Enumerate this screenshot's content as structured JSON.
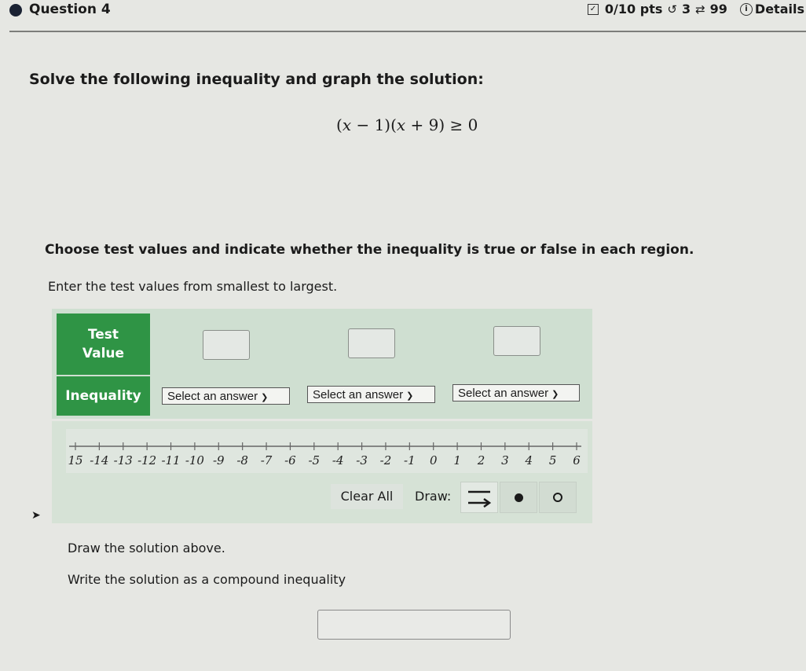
{
  "header": {
    "question_title": "Question 4",
    "points": "0/10 pts",
    "retries": "3",
    "attempts": "99",
    "details_label": "Details",
    "icons": [
      "checkbox-icon",
      "undo-icon",
      "repeat-icon",
      "info-icon"
    ]
  },
  "prompt": "Solve the following inequality and graph the solution:",
  "equation": {
    "parts": [
      "(",
      "x",
      " − 1)(",
      "x",
      " + 9) ≥ 0"
    ]
  },
  "instructions": {
    "choose": "Choose test values and indicate whether the inequality is true or false in each region.",
    "order": "Enter the test values from smallest to largest.",
    "draw": "Draw the solution above.",
    "compound": "Write the solution as a compound inequality"
  },
  "table": {
    "row1_label": "Test Value",
    "row2_label": "Inequality",
    "test_values": [
      "",
      "",
      ""
    ],
    "selects": [
      {
        "value": "Select an answer"
      },
      {
        "value": "Select an answer"
      },
      {
        "value": "Select an answer"
      }
    ]
  },
  "number_line": {
    "min": -15,
    "max": 6,
    "ticks": [
      "15",
      "-14",
      "-13",
      "-12",
      "-11",
      "-10",
      "-9",
      "-8",
      "-7",
      "-6",
      "-5",
      "-4",
      "-3",
      "-2",
      "-1",
      "0",
      "1",
      "2",
      "3",
      "4",
      "5",
      "6"
    ]
  },
  "graph_tools": {
    "clear_label": "Clear All",
    "draw_label": "Draw:",
    "tools": [
      "ray-tool",
      "closed-dot-tool",
      "open-dot-tool"
    ],
    "active_tool": "ray-tool"
  },
  "answer_input": {
    "value": ""
  }
}
